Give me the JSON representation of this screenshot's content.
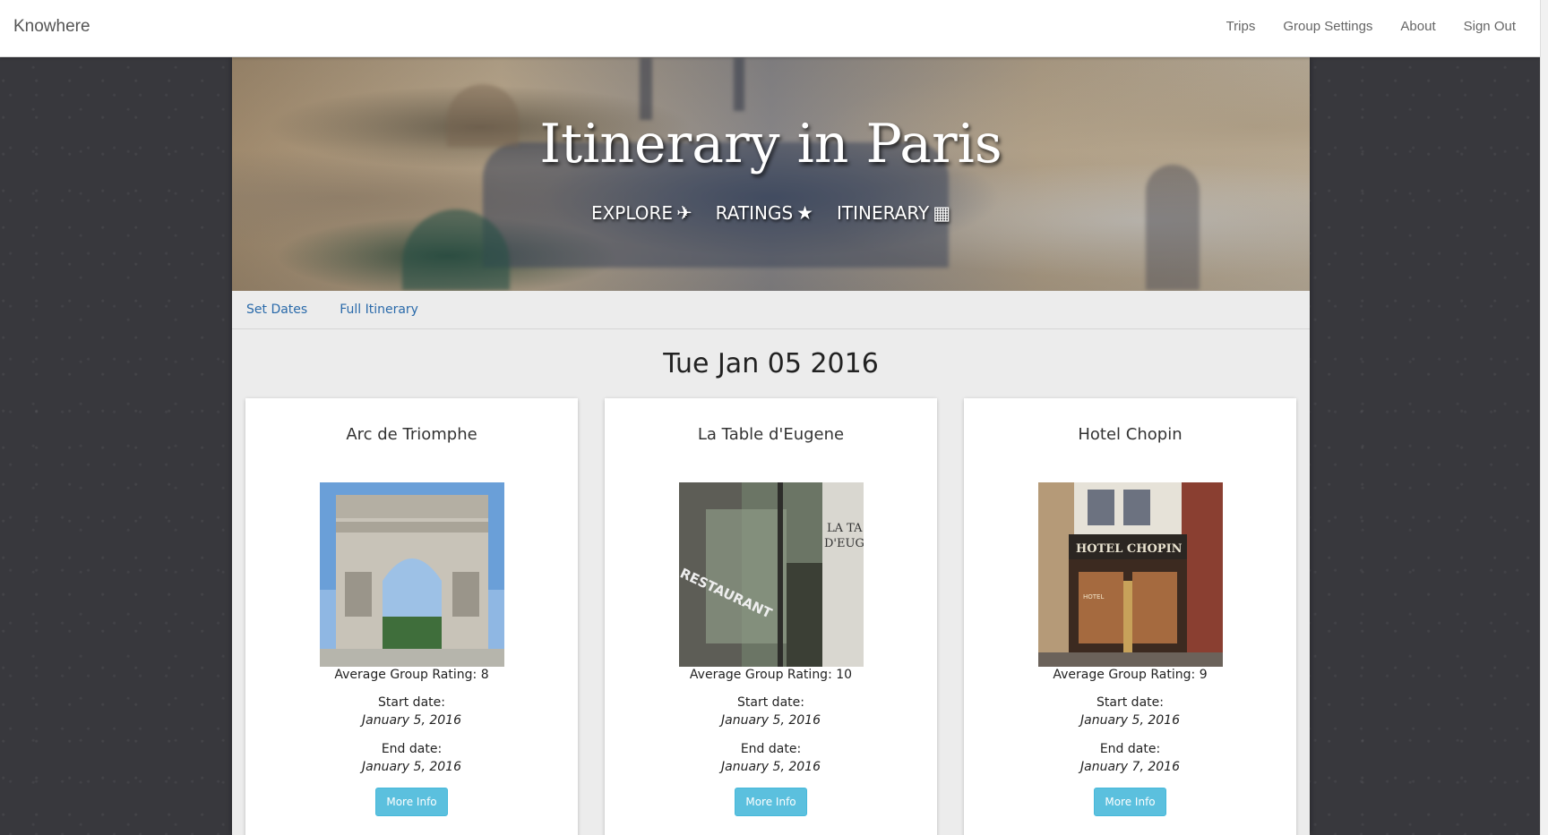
{
  "navbar": {
    "brand": "Knowhere",
    "links": [
      "Trips",
      "Group Settings",
      "About",
      "Sign Out"
    ]
  },
  "hero": {
    "title": "Itinerary in Paris",
    "menu": [
      {
        "label": "EXPLORE",
        "icon": "plane-icon",
        "glyph": "✈"
      },
      {
        "label": "RATINGS",
        "icon": "star-icon",
        "glyph": "★"
      },
      {
        "label": "ITINERARY",
        "icon": "calendar-icon",
        "glyph": "▦"
      }
    ]
  },
  "subnav": {
    "links": [
      "Set Dates",
      "Full Itinerary"
    ]
  },
  "date_heading": "Tue Jan 05 2016",
  "cards": [
    {
      "title": "Arc de Triomphe",
      "image": "arc-de-triomphe-photo",
      "rating": "Average Group Rating: 8",
      "start_label": "Start date:",
      "start_date": "January 5, 2016",
      "end_label": "End date:",
      "end_date": "January 5, 2016",
      "button": "More Info"
    },
    {
      "title": "La Table d'Eugene",
      "image": "restaurant-storefront-photo",
      "rating": "Average Group Rating: 10",
      "start_label": "Start date:",
      "start_date": "January 5, 2016",
      "end_label": "End date:",
      "end_date": "January 5, 2016",
      "button": "More Info"
    },
    {
      "title": "Hotel Chopin",
      "image": "hotel-chopin-facade-photo",
      "rating": "Average Group Rating: 9",
      "start_label": "Start date:",
      "start_date": "January 5, 2016",
      "end_label": "End date:",
      "end_date": "January 7, 2016",
      "button": "More Info"
    }
  ],
  "image_text": {
    "restaurant_sign": "RESTAURANT",
    "restaurant_window": "LA TA",
    "restaurant_window2": "D'EUG",
    "hotel_sign": "HOTEL CHOPIN",
    "hotel_door": "HOTEL"
  },
  "colors": {
    "button": "#5bc0de",
    "link": "#2a6aaa",
    "content_bg": "#ececec",
    "page_bg": "#38383d"
  }
}
